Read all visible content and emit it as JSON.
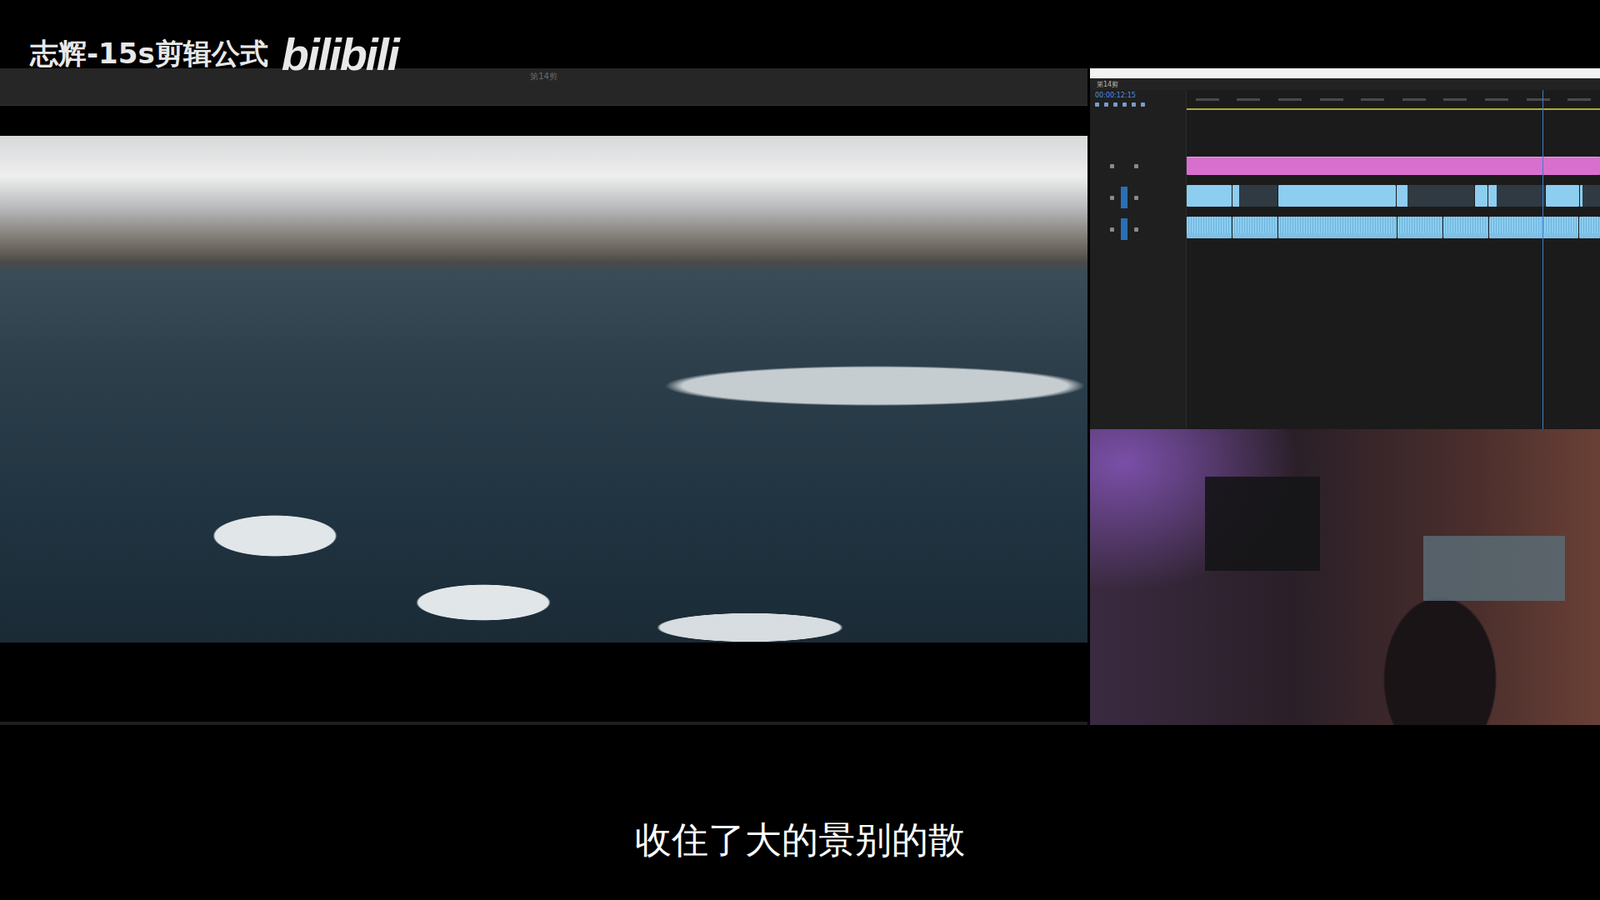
{
  "watermark": {
    "channel": "志辉-15s剪辑公式",
    "logo": "bilibili"
  },
  "preview": {
    "title": "第14剪"
  },
  "timeline": {
    "tab": "第14剪",
    "timecode": "00:00:12:15",
    "playhead": 0.86,
    "tracks": [
      {
        "kind": "graphics",
        "clips": [
          {
            "kind": "graphic",
            "share": 1
          }
        ]
      },
      {
        "kind": "video",
        "clips": [
          {
            "kind": "plain",
            "share": 0.11
          },
          {
            "kind": "thumb",
            "share": 0.11
          },
          {
            "kind": "plain",
            "share": 0.29
          },
          {
            "kind": "thumb",
            "share": 0.19
          },
          {
            "kind": "plain",
            "share": 0.03
          },
          {
            "kind": "thumb",
            "share": 0.14
          },
          {
            "kind": "plain",
            "share": 0.08
          },
          {
            "kind": "thumb",
            "share": 0.05
          }
        ]
      },
      {
        "kind": "audio",
        "clips": [
          {
            "kind": "wave",
            "share": 0.11
          },
          {
            "kind": "wave",
            "share": 0.11
          },
          {
            "kind": "wave",
            "share": 0.29
          },
          {
            "kind": "wave",
            "share": 0.11
          },
          {
            "kind": "wave",
            "share": 0.11
          },
          {
            "kind": "wave",
            "share": 0.22
          },
          {
            "kind": "wave",
            "share": 0.05
          }
        ]
      }
    ]
  },
  "subtitle": "收住了大的景别的散"
}
